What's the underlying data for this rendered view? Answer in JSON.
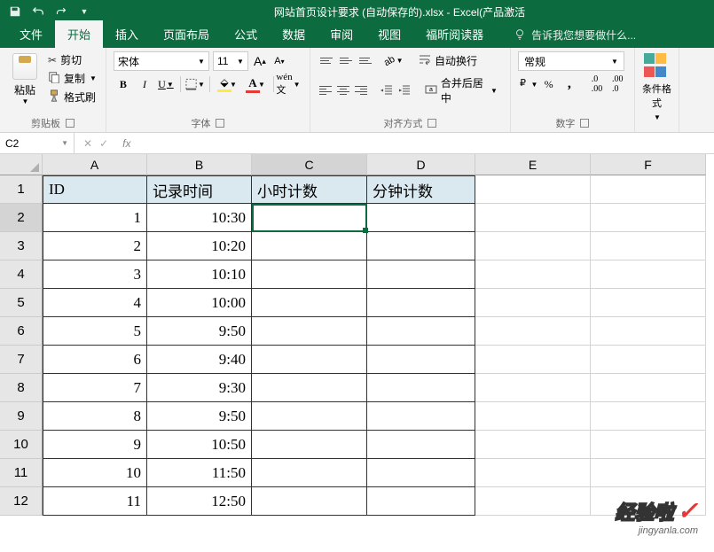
{
  "titlebar": {
    "title": "网站首页设计要求 (自动保存的).xlsx - Excel(产品激活"
  },
  "tabs": {
    "file": "文件",
    "home": "开始",
    "insert": "插入",
    "layout": "页面布局",
    "formulas": "公式",
    "data": "数据",
    "review": "审阅",
    "view": "视图",
    "foxit": "福昕阅读器",
    "tellme": "告诉我您想要做什么..."
  },
  "ribbon": {
    "clipboard": {
      "paste": "粘贴",
      "cut": "剪切",
      "copy": "复制",
      "format_painter": "格式刷",
      "label": "剪贴板"
    },
    "font": {
      "name": "宋体",
      "size": "11",
      "bold": "B",
      "italic": "I",
      "underline": "U",
      "label": "字体"
    },
    "alignment": {
      "wrap": "自动换行",
      "merge": "合并后居中",
      "label": "对齐方式"
    },
    "number": {
      "format": "常规",
      "label": "数字"
    },
    "cond": {
      "label": "条件格式"
    }
  },
  "formula_bar": {
    "name_box": "C2",
    "fx": "fx",
    "formula": ""
  },
  "columns": [
    "A",
    "B",
    "C",
    "D",
    "E",
    "F"
  ],
  "row_numbers": [
    "1",
    "2",
    "3",
    "4",
    "5",
    "6",
    "7",
    "8",
    "9",
    "10",
    "11",
    "12"
  ],
  "headers": {
    "A": "ID",
    "B": "记录时间",
    "C": "小时计数",
    "D": "分钟计数"
  },
  "table_data": [
    {
      "id": "1",
      "time": "10:30"
    },
    {
      "id": "2",
      "time": "10:20"
    },
    {
      "id": "3",
      "time": "10:10"
    },
    {
      "id": "4",
      "time": "10:00"
    },
    {
      "id": "5",
      "time": "9:50"
    },
    {
      "id": "6",
      "time": "9:40"
    },
    {
      "id": "7",
      "time": "9:30"
    },
    {
      "id": "8",
      "time": "9:50"
    },
    {
      "id": "9",
      "time": "10:50"
    },
    {
      "id": "10",
      "time": "11:50"
    },
    {
      "id": "11",
      "time": "12:50"
    }
  ],
  "selected_cell": "C2",
  "watermark": {
    "main": "经验啦",
    "sub": "jingyanla.com"
  }
}
